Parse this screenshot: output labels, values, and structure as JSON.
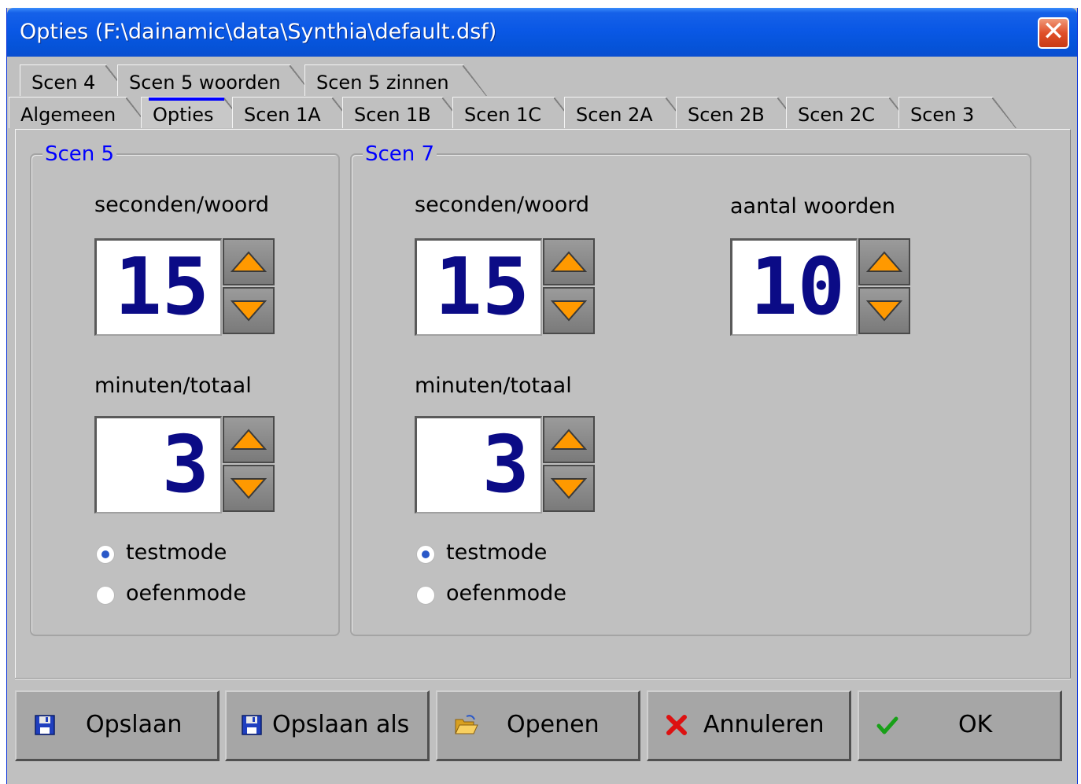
{
  "window": {
    "title": "Opties (F:\\dainamic\\data\\Synthia\\default.dsf)"
  },
  "tabs": {
    "row_back": [
      "Scen 4",
      "Scen 5 woorden",
      "Scen 5 zinnen"
    ],
    "row_front": [
      "Algemeen",
      "Opties",
      "Scen 1A",
      "Scen 1B",
      "Scen 1C",
      "Scen 2A",
      "Scen 2B",
      "Scen 2C",
      "Scen 3"
    ],
    "active": "Opties"
  },
  "scen5": {
    "title": "Scen 5",
    "seconden_label": "seconden/woord",
    "seconden_value": "15",
    "minuten_label": "minuten/totaal",
    "minuten_value": "3",
    "radio_testmode": "testmode",
    "radio_oefenmode": "oefenmode",
    "selected_mode": "testmode"
  },
  "scen7": {
    "title": "Scen 7",
    "seconden_label": "seconden/woord",
    "seconden_value": "15",
    "minuten_label": "minuten/totaal",
    "minuten_value": "3",
    "aantal_label": "aantal woorden",
    "aantal_value": "10",
    "radio_testmode": "testmode",
    "radio_oefenmode": "oefenmode",
    "selected_mode": "testmode"
  },
  "footer": {
    "save_label": "Opslaan",
    "save_as_label": "Opslaan als",
    "open_label": "Openen",
    "cancel_label": "Annuleren",
    "ok_label": "OK"
  },
  "colors": {
    "accent": "#0000ff",
    "digits": "#0b0b86",
    "spin_arrow": "#ff9900",
    "titlebar": "#0a58e6"
  },
  "icons": {
    "close": "close-icon",
    "save": "floppy-disk-icon",
    "save_as": "floppy-disk-icon",
    "open": "open-folder-icon",
    "cancel": "red-x-icon",
    "ok": "green-check-icon"
  }
}
